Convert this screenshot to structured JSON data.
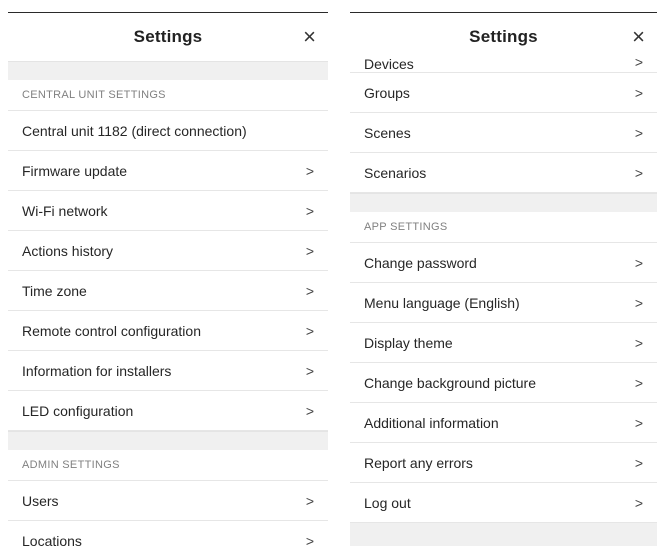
{
  "left": {
    "title": "Settings",
    "close": "×",
    "sections": [
      {
        "header": "CENTRAL UNIT SETTINGS",
        "items": [
          {
            "label": "Central unit 1182 (direct connection)",
            "chevron": ""
          },
          {
            "label": "Firmware update",
            "chevron": ">"
          },
          {
            "label": "Wi-Fi network",
            "chevron": ">"
          },
          {
            "label": "Actions history",
            "chevron": ">"
          },
          {
            "label": "Time zone",
            "chevron": ">"
          },
          {
            "label": "Remote control configuration",
            "chevron": ">"
          },
          {
            "label": "Information for installers",
            "chevron": ">"
          },
          {
            "label": "LED configuration",
            "chevron": ">"
          }
        ]
      },
      {
        "header": "ADMIN SETTINGS",
        "items": [
          {
            "label": "Users",
            "chevron": ">"
          },
          {
            "label": "Locations",
            "chevron": ">"
          }
        ]
      }
    ]
  },
  "right": {
    "title": "Settings",
    "close": "×",
    "partial_item": {
      "label": "Devices",
      "chevron": ">"
    },
    "items_top": [
      {
        "label": "Groups",
        "chevron": ">"
      },
      {
        "label": "Scenes",
        "chevron": ">"
      },
      {
        "label": "Scenarios",
        "chevron": ">"
      }
    ],
    "app_section": {
      "header": "APP SETTINGS",
      "items": [
        {
          "label": "Change password",
          "chevron": ">"
        },
        {
          "label": "Menu language (English)",
          "chevron": ">"
        },
        {
          "label": "Display theme",
          "chevron": ">"
        },
        {
          "label": "Change background picture",
          "chevron": ">"
        },
        {
          "label": "Additional information",
          "chevron": ">"
        },
        {
          "label": "Report any errors",
          "chevron": ">"
        },
        {
          "label": "Log out",
          "chevron": ">"
        }
      ]
    }
  },
  "colors": {
    "section_background": "#f0f0f0",
    "divider": "#e6e6e6",
    "section_header_text": "#808080"
  }
}
